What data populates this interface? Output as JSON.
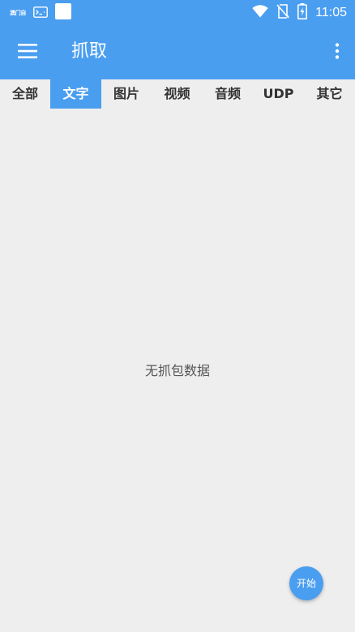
{
  "status_bar": {
    "time": "11:05",
    "left_text": "澳门自",
    "left_icons": [
      "terminal-icon",
      "white-square-icon"
    ],
    "right_icons": [
      "wifi-icon",
      "no-sim-icon",
      "battery-charging-icon"
    ]
  },
  "app_bar": {
    "title": "抓取",
    "menu_icon": "hamburger-menu-icon",
    "more_icon": "more-vert-icon"
  },
  "tabs": [
    {
      "label": "全部",
      "active": false
    },
    {
      "label": "文字",
      "active": true
    },
    {
      "label": "图片",
      "active": false
    },
    {
      "label": "视频",
      "active": false
    },
    {
      "label": "音频",
      "active": false
    },
    {
      "label": "UDP",
      "active": false
    },
    {
      "label": "其它",
      "active": false
    }
  ],
  "empty_state": {
    "message": "无抓包数据"
  },
  "fab": {
    "label": "开始"
  },
  "colors": {
    "primary": "#4a9ef0",
    "background": "#eeeeee",
    "tab_text": "#333333",
    "empty_text": "#555555"
  }
}
